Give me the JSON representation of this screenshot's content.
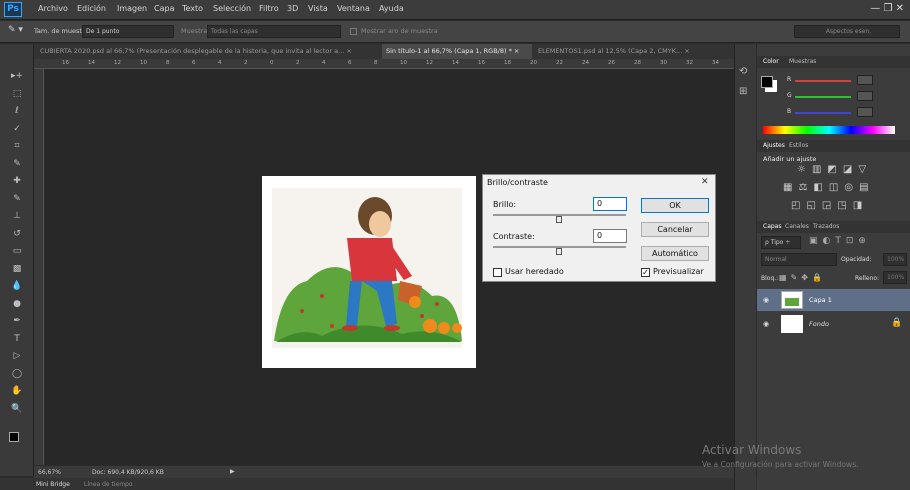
{
  "app": {
    "logo": "Ps",
    "menu": [
      "Archivo",
      "Edición",
      "Imagen",
      "Capa",
      "Texto",
      "Selección",
      "Filtro",
      "3D",
      "Vista",
      "Ventana",
      "Ayuda"
    ],
    "window_controls": "— ❐ ✕"
  },
  "options": {
    "sample_size_label": "Tam. de muestra:",
    "sample_size_value": "De 1 punto",
    "sample_label": "Muestra:",
    "sample_value": "Todas las capas",
    "ring_label": "Mostrar aro de muestra",
    "workspace": "Aspectos esen."
  },
  "tabs": [
    {
      "label": "CUBIERTA 2020.psd al 66,7% (Presentación desplegable de la historia, que invita al lector a... ×",
      "active": false
    },
    {
      "label": "Sin título-1 al 66,7% (Capa 1, RGB/8) * ×",
      "active": true
    },
    {
      "label": "ELEMENTOS1.psd al 12,5% (Capa 2, CMYK... ×",
      "active": false
    }
  ],
  "ruler_numbers": [
    "16",
    "14",
    "12",
    "10",
    "8",
    "6",
    "4",
    "2",
    "0",
    "2",
    "4",
    "6",
    "8",
    "10",
    "12",
    "14",
    "16",
    "18",
    "20",
    "22",
    "24",
    "26",
    "28",
    "30",
    "32",
    "34"
  ],
  "status": {
    "zoom": "66,67%",
    "doc": "Doc: 690,4 KB/920,6 KB"
  },
  "bottom": {
    "tabs": [
      "Mini Bridge",
      "Línea de tiempo"
    ]
  },
  "panels": {
    "color_tabs": [
      "Color",
      "Muestras"
    ],
    "rgb_labels": [
      "R",
      "G",
      "B"
    ],
    "adjust_tabs": [
      "Ajustes",
      "Estilos"
    ],
    "adjust_title": "Añadir un ajuste",
    "adjust_icons_row1": [
      "☼",
      "▥",
      "◩",
      "◪",
      "▽"
    ],
    "adjust_icons_row2": [
      "▦",
      "⚖",
      "◧",
      "◫",
      "◎",
      "▤"
    ],
    "adjust_icons_row3": [
      "◰",
      "◱",
      "◲",
      "◳",
      "◨"
    ],
    "layers_tabs": [
      "Capas",
      "Canales",
      "Trazados"
    ],
    "kind_label": "ρ Tipo ÷",
    "blend_mode": "Normal",
    "opacity_label": "Opacidad:",
    "opacity_value": "100%",
    "lock_label": "Bloq.:",
    "fill_label": "Relleno:",
    "fill_value": "100%",
    "layers": [
      {
        "name": "Capa 1",
        "selected": true
      },
      {
        "name": "Fondo",
        "selected": false
      }
    ]
  },
  "dialog": {
    "title": "Brillo/contraste",
    "close": "✕",
    "brightness_label": "Brillo:",
    "brightness_value": "0",
    "contrast_label": "Contraste:",
    "contrast_value": "0",
    "ok": "OK",
    "cancel": "Cancelar",
    "auto": "Automático",
    "legacy": "Usar heredado",
    "preview": "Previsualizar",
    "preview_checked": true,
    "legacy_checked": false
  },
  "watermark": {
    "line1": "Activar Windows",
    "line2": "Ve a Configuración para activar Windows."
  }
}
